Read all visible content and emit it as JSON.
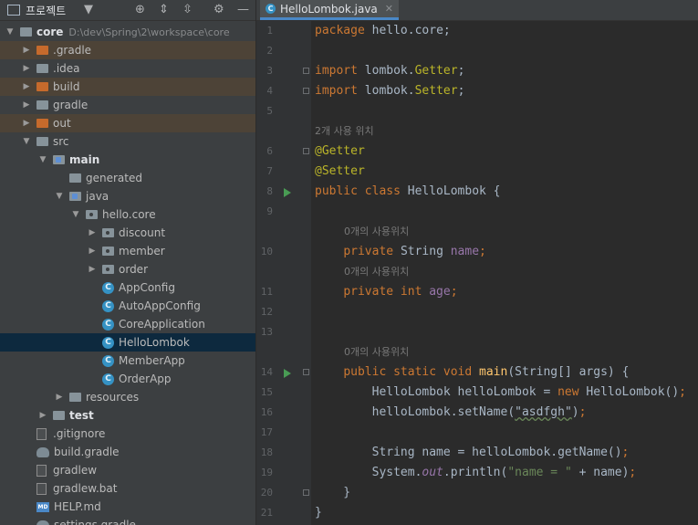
{
  "project_panel": {
    "title": "프로젝트",
    "tree": [
      {
        "label": "core",
        "indent": 0,
        "arrow": "open",
        "icon": "folder-module",
        "bold": true,
        "path": "D:\\dev\\Spring\\2\\workspace\\core"
      },
      {
        "label": ".gradle",
        "indent": 1,
        "arrow": "closed",
        "icon": "folder-excluded",
        "excluded": true
      },
      {
        "label": ".idea",
        "indent": 1,
        "arrow": "closed",
        "icon": "folder"
      },
      {
        "label": "build",
        "indent": 1,
        "arrow": "closed",
        "icon": "folder-excluded",
        "excluded": true
      },
      {
        "label": "gradle",
        "indent": 1,
        "arrow": "closed",
        "icon": "folder"
      },
      {
        "label": "out",
        "indent": 1,
        "arrow": "closed",
        "icon": "folder-excluded",
        "excluded": true
      },
      {
        "label": "src",
        "indent": 1,
        "arrow": "open",
        "icon": "folder"
      },
      {
        "label": "main",
        "indent": 2,
        "arrow": "open",
        "icon": "folder-src",
        "bold": true
      },
      {
        "label": "generated",
        "indent": 3,
        "arrow": "none",
        "icon": "folder-generated"
      },
      {
        "label": "java",
        "indent": 3,
        "arrow": "open",
        "icon": "folder-src"
      },
      {
        "label": "hello.core",
        "indent": 4,
        "arrow": "open",
        "icon": "folder-package"
      },
      {
        "label": "discount",
        "indent": 5,
        "arrow": "closed",
        "icon": "folder-package"
      },
      {
        "label": "member",
        "indent": 5,
        "arrow": "closed",
        "icon": "folder-package"
      },
      {
        "label": "order",
        "indent": 5,
        "arrow": "closed",
        "icon": "folder-package"
      },
      {
        "label": "AppConfig",
        "indent": 5,
        "arrow": "none",
        "icon": "class"
      },
      {
        "label": "AutoAppConfig",
        "indent": 5,
        "arrow": "none",
        "icon": "class"
      },
      {
        "label": "CoreApplication",
        "indent": 5,
        "arrow": "none",
        "icon": "class"
      },
      {
        "label": "HelloLombok",
        "indent": 5,
        "arrow": "none",
        "icon": "class",
        "selected": true
      },
      {
        "label": "MemberApp",
        "indent": 5,
        "arrow": "none",
        "icon": "class"
      },
      {
        "label": "OrderApp",
        "indent": 5,
        "arrow": "none",
        "icon": "class"
      },
      {
        "label": "resources",
        "indent": 3,
        "arrow": "closed",
        "icon": "folder-resources"
      },
      {
        "label": "test",
        "indent": 2,
        "arrow": "closed",
        "icon": "folder",
        "bold": true
      },
      {
        "label": ".gitignore",
        "indent": 1,
        "arrow": "none",
        "icon": "file"
      },
      {
        "label": "build.gradle",
        "indent": 1,
        "arrow": "none",
        "icon": "gradle"
      },
      {
        "label": "gradlew",
        "indent": 1,
        "arrow": "none",
        "icon": "file"
      },
      {
        "label": "gradlew.bat",
        "indent": 1,
        "arrow": "none",
        "icon": "file"
      },
      {
        "label": "HELP.md",
        "indent": 1,
        "arrow": "none",
        "icon": "markdown"
      },
      {
        "label": "settings.gradle",
        "indent": 1,
        "arrow": "none",
        "icon": "gradle"
      }
    ]
  },
  "editor": {
    "tab_label": "HelloLombok.java",
    "lines": [
      {
        "n": "1",
        "tokens": [
          [
            "k",
            "package "
          ],
          [
            "",
            "hello.core;"
          ]
        ]
      },
      {
        "n": "2",
        "tokens": []
      },
      {
        "n": "3",
        "tokens": [
          [
            "k",
            "import "
          ],
          [
            "",
            "lombok."
          ],
          [
            "an",
            "Getter"
          ],
          [
            "",
            "; "
          ]
        ],
        "fold": true
      },
      {
        "n": "4",
        "tokens": [
          [
            "k",
            "import "
          ],
          [
            "",
            "lombok."
          ],
          [
            "an",
            "Setter"
          ],
          [
            "",
            ";"
          ]
        ],
        "fold": true
      },
      {
        "n": "5",
        "tokens": []
      },
      {
        "hint": "2개 사용 위치"
      },
      {
        "n": "6",
        "tokens": [
          [
            "an",
            "@Getter"
          ]
        ],
        "fold": true
      },
      {
        "n": "7",
        "tokens": [
          [
            "an",
            "@Setter"
          ]
        ]
      },
      {
        "n": "8",
        "tokens": [
          [
            "k",
            "public class "
          ],
          [
            "",
            "HelloLombok {"
          ]
        ],
        "run": true
      },
      {
        "n": "9",
        "tokens": []
      },
      {
        "hint": "0개의 사용위치",
        "indent": "    "
      },
      {
        "n": "10",
        "tokens": [
          [
            "",
            "    "
          ],
          [
            "k",
            "private "
          ],
          [
            "",
            "String "
          ],
          [
            "f",
            "name"
          ],
          [
            "k",
            ";"
          ]
        ]
      },
      {
        "hint": "0개의 사용위치",
        "indent": "    "
      },
      {
        "n": "11",
        "tokens": [
          [
            "",
            "    "
          ],
          [
            "k",
            "private int "
          ],
          [
            "f",
            "age"
          ],
          [
            "k",
            ";"
          ]
        ]
      },
      {
        "n": "12",
        "tokens": []
      },
      {
        "n": "13",
        "tokens": []
      },
      {
        "hint": "0개의 사용위치",
        "indent": "    "
      },
      {
        "n": "14",
        "tokens": [
          [
            "",
            "    "
          ],
          [
            "k",
            "public static void "
          ],
          [
            "m",
            "main"
          ],
          [
            "",
            "(String[] args) {"
          ]
        ],
        "run": true,
        "fold": true
      },
      {
        "n": "15",
        "tokens": [
          [
            "",
            "        HelloLombok helloLombok = "
          ],
          [
            "k",
            "new "
          ],
          [
            "",
            "HelloLombok()"
          ],
          [
            "k",
            ";"
          ]
        ]
      },
      {
        "n": "16",
        "tokens": [
          [
            "",
            "        helloLombok.setName("
          ],
          [
            "sq",
            "\"asdfgh\""
          ],
          [
            "",
            ")"
          ],
          [
            "k",
            ";"
          ]
        ]
      },
      {
        "n": "17",
        "tokens": []
      },
      {
        "n": "18",
        "tokens": [
          [
            "",
            "        String name = helloLombok.getName()"
          ],
          [
            "k",
            ";"
          ]
        ]
      },
      {
        "n": "19",
        "tokens": [
          [
            "",
            "        System."
          ],
          [
            "fi",
            "out"
          ],
          [
            "",
            ".println("
          ],
          [
            "s",
            "\"name = \""
          ],
          [
            "",
            " + name)"
          ],
          [
            "k",
            ";"
          ]
        ]
      },
      {
        "n": "20",
        "tokens": [
          [
            "",
            "    }"
          ]
        ],
        "fold": true
      },
      {
        "n": "21",
        "tokens": [
          [
            "",
            "}"
          ]
        ]
      }
    ]
  }
}
